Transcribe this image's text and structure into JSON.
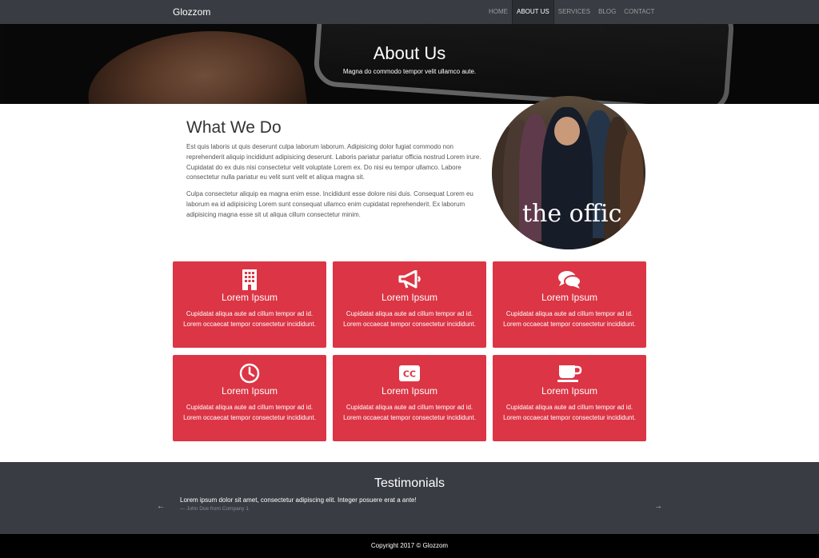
{
  "navbar": {
    "brand": "Glozzom",
    "items": [
      {
        "label": "HOME"
      },
      {
        "label": "ABOUT US"
      },
      {
        "label": "SERVICES"
      },
      {
        "label": "BLOG"
      },
      {
        "label": "CONTACT"
      }
    ],
    "active_item": "ABOUT US"
  },
  "hero": {
    "title": "About Us",
    "subtitle": "Magna do commodo tempor velit ullamco aute."
  },
  "about": {
    "heading": "What We Do",
    "paragraph1": "Est quis laboris ut quis deserunt culpa laborum laborum. Adipisicing dolor fugiat commodo non reprehenderit aliquip incididunt adipisicing deserunt. Laboris pariatur pariatur officia nostrud Lorem irure. Cupidatat do ex duis nisi consectetur velit voluptate Lorem ex. Do nisi eu tempor ullamco. Labore consectetur nulla pariatur eu velit sunt velit et aliqua magna sit.",
    "paragraph2": "Culpa consectetur aliquip ea magna enim esse. Incididunt esse dolore nisi duis. Consequat Lorem eu laborum ea id adipisicing Lorem sunt consequat ullamco enim cupidatat reprehenderit. Ex laborum adipisicing magna esse sit ut aliqua cillum consectetur minim.",
    "image_caption": "the offic"
  },
  "cards": [
    {
      "icon": "building-icon",
      "title": "Lorem Ipsum",
      "text": "Cupidatat aliqua aute ad cillum tempor ad id. Lorem occaecat tempor consectetur incididunt."
    },
    {
      "icon": "bullhorn-icon",
      "title": "Lorem Ipsum",
      "text": "Cupidatat aliqua aute ad cillum tempor ad id. Lorem occaecat tempor consectetur incididunt."
    },
    {
      "icon": "comments-icon",
      "title": "Lorem Ipsum",
      "text": "Cupidatat aliqua aute ad cillum tempor ad id. Lorem occaecat tempor consectetur incididunt."
    },
    {
      "icon": "clock-icon",
      "title": "Lorem Ipsum",
      "text": "Cupidatat aliqua aute ad cillum tempor ad id. Lorem occaecat tempor consectetur incididunt."
    },
    {
      "icon": "closed-captioning-icon",
      "title": "Lorem Ipsum",
      "text": "Cupidatat aliqua aute ad cillum tempor ad id. Lorem occaecat tempor consectetur incididunt."
    },
    {
      "icon": "coffee-icon",
      "title": "Lorem Ipsum",
      "text": "Cupidatat aliqua aute ad cillum tempor ad id. Lorem occaecat tempor consectetur incididunt."
    }
  ],
  "testimonials": {
    "heading": "Testimonials",
    "quote": "Lorem ipsum dolor sit amet, consectetur adipiscing elit. Integer posuere erat a ante!",
    "author": "— John Doe from Company 1",
    "prev_arrow": "←",
    "next_arrow": "→"
  },
  "footer": {
    "copyright": "Copyright 2017 © Glozzom"
  },
  "colors": {
    "navbar": "#393c42",
    "card": "#dc3545",
    "footer": "#000000"
  }
}
